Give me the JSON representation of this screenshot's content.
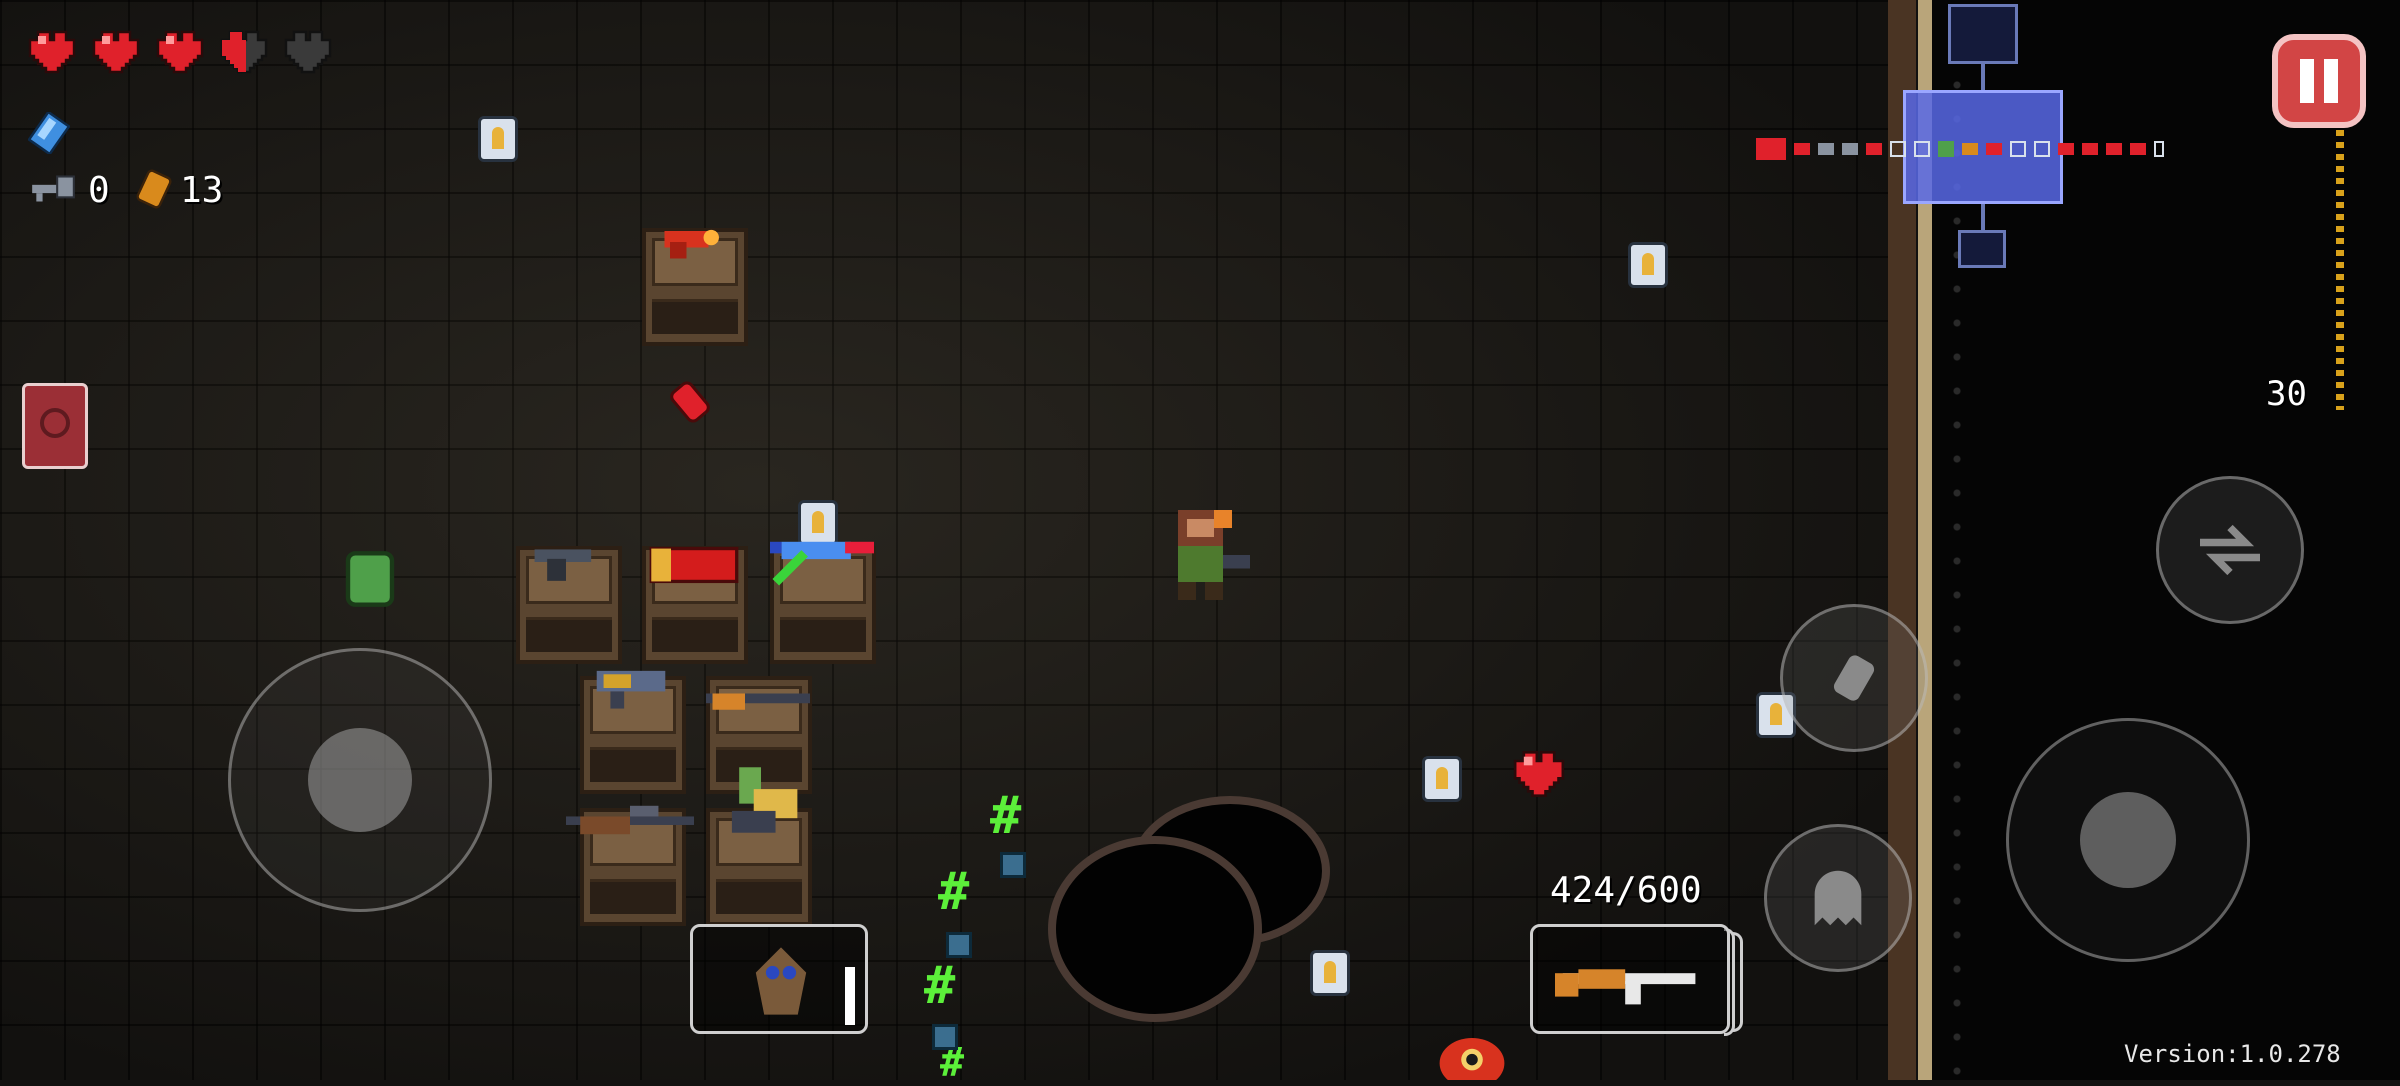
{
  "game": {
    "health": {
      "full_hearts": 3,
      "half_hearts": 1,
      "empty_hearts": 1,
      "max_hearts": 5
    },
    "blanks": {
      "count": 1,
      "icon": "blank-icon"
    },
    "keys": {
      "count": "0",
      "icon": "key-icon"
    },
    "shells_currency": {
      "count": "13",
      "icon": "shell-currency-icon"
    },
    "active_item": {
      "icon": "book-icon"
    },
    "ammo": {
      "display": "424/600",
      "current": 424,
      "max": 600
    },
    "equipped_gun": {
      "icon": "ak47-gun-icon"
    },
    "side_ammo_counter": "30",
    "version": "Version:1.0.278",
    "controls": {
      "move_stick": "move-joystick",
      "aim_stick": "aim-joystick",
      "reload": "reload-button",
      "blank": "blank-button",
      "dodge": "dodge-roll-button",
      "pause": "pause-button"
    }
  }
}
